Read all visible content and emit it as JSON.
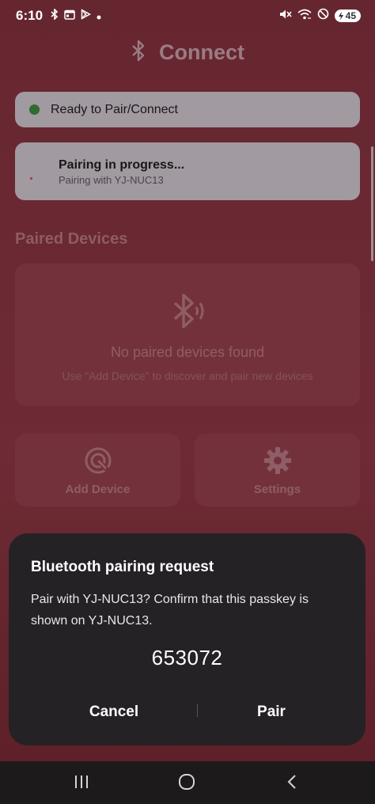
{
  "status_bar": {
    "time": "6:10",
    "battery": "45",
    "left_icons": [
      "bluetooth-icon",
      "calendar-icon",
      "play-store-icon",
      "notification-dot-icon"
    ],
    "right_icons": [
      "mute-icon",
      "wifi-icon",
      "do-not-disturb-icon",
      "battery-charging-icon"
    ]
  },
  "header": {
    "title": "Connect",
    "icon": "bluetooth-icon"
  },
  "status_card": {
    "text": "Ready to Pair/Connect",
    "dot_color": "#2f6b2f"
  },
  "pairing_card": {
    "title": "Pairing in progress...",
    "subtitle": "Pairing with YJ-NUC13"
  },
  "paired_devices": {
    "section_title": "Paired Devices",
    "empty_title": "No paired devices found",
    "empty_subtitle": "Use \"Add Device\" to discover and pair new devices"
  },
  "actions": [
    {
      "label": "Add Device",
      "icon": "radar-icon"
    },
    {
      "label": "Settings",
      "icon": "gear-icon"
    }
  ],
  "dialog": {
    "title": "Bluetooth pairing request",
    "message": "Pair with YJ-NUC13? Confirm that this passkey is shown on YJ-NUC13.",
    "passkey": "653072",
    "cancel_label": "Cancel",
    "pair_label": "Pair"
  },
  "navbar": {
    "icons": [
      "recents-icon",
      "home-icon",
      "back-icon"
    ]
  },
  "colors": {
    "background": "#6b2a33",
    "card": "#a19aa0",
    "dialog": "#242224"
  }
}
